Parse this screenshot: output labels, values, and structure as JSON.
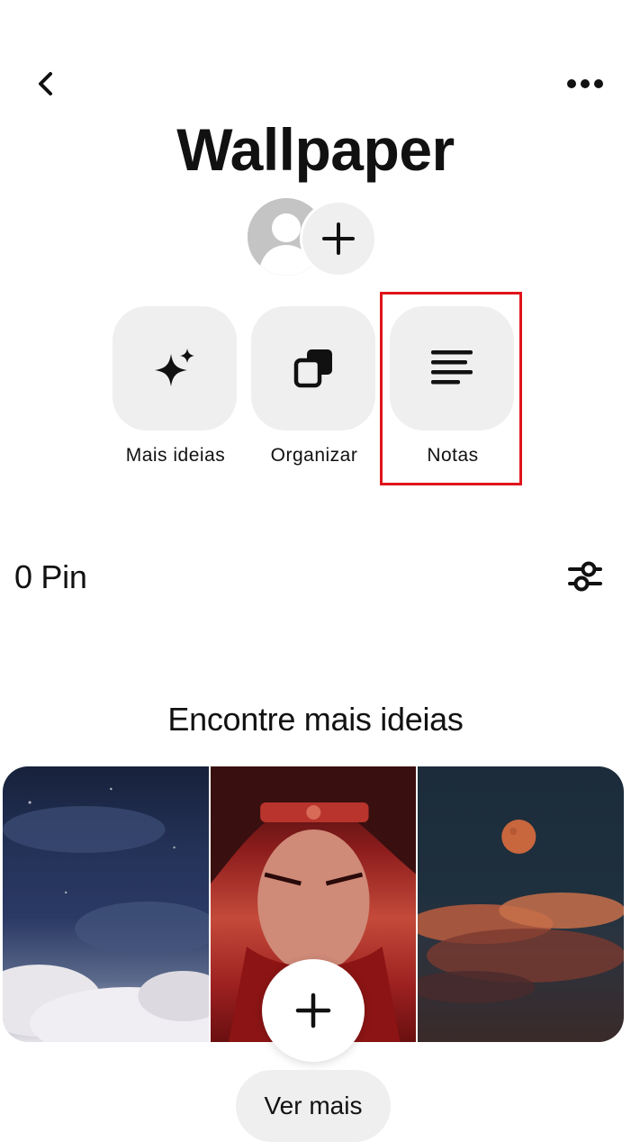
{
  "board": {
    "title": "Wallpaper"
  },
  "actions": [
    {
      "label": "Mais ideias",
      "icon": "sparkle-icon"
    },
    {
      "label": "Organizar",
      "icon": "organize-icon"
    },
    {
      "label": "Notas",
      "icon": "notes-icon"
    }
  ],
  "pins": {
    "count_label": "0 Pin"
  },
  "more_ideas": {
    "title": "Encontre mais ideias",
    "images": [
      "night-clouds-image",
      "anime-character-image",
      "moon-clouds-image"
    ],
    "see_more_label": "Ver mais"
  },
  "colors": {
    "highlight": "#e0141b",
    "tile_bg": "#efefef"
  }
}
